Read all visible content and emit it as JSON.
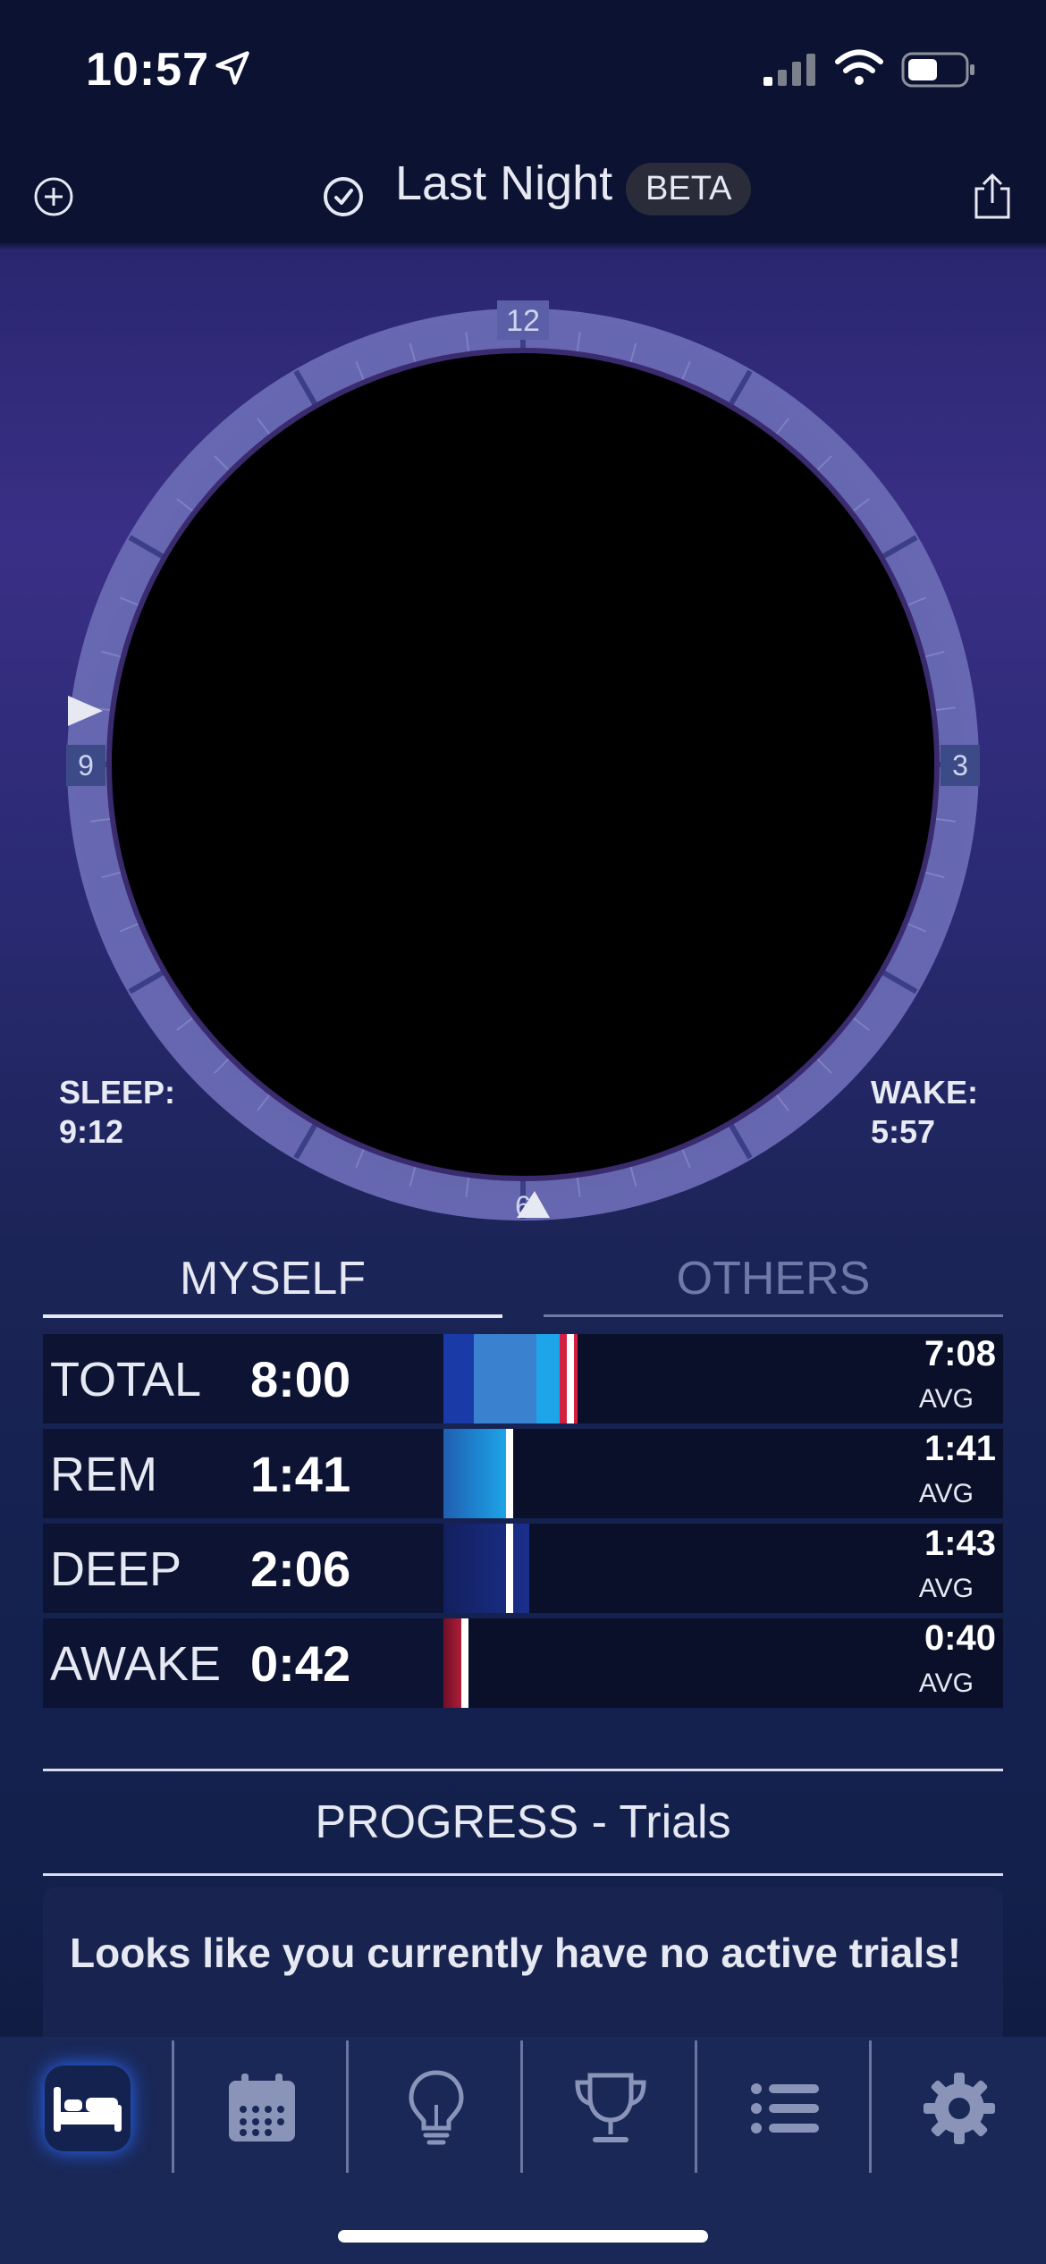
{
  "status_bar": {
    "time": "10:57",
    "icons": [
      "location-arrow-icon",
      "cellular-signal-icon",
      "wifi-icon",
      "battery-icon"
    ]
  },
  "header": {
    "title": "Last Night",
    "badge": "BETA",
    "left_icon": "add-circle-icon",
    "title_icon": "replay-icon",
    "right_icon": "share-icon"
  },
  "dial": {
    "hour_labels": {
      "top": "12",
      "right": "3",
      "bottom": "6",
      "left": "9"
    },
    "sleep_label": "SLEEP:",
    "sleep_time": "9:12",
    "wake_label": "WAKE:",
    "wake_time": "5:57"
  },
  "segments": {
    "myself": "MYSELF",
    "others": "OTHERS",
    "selected": "MYSELF"
  },
  "stats": [
    {
      "label": "TOTAL",
      "value": "8:00",
      "avg": "7:08",
      "avg_label": "AVG"
    },
    {
      "label": "REM",
      "value": "1:41",
      "avg": "1:41",
      "avg_label": "AVG"
    },
    {
      "label": "DEEP",
      "value": "2:06",
      "avg": "1:43",
      "avg_label": "AVG"
    },
    {
      "label": "AWAKE",
      "value": "0:42",
      "avg": "0:40",
      "avg_label": "AVG"
    }
  ],
  "progress": {
    "title": "PROGRESS - Trials",
    "empty_message": "Looks like you currently have no active trials!"
  },
  "tab_bar": {
    "tabs": [
      "bed-icon",
      "calendar-icon",
      "lightbulb-icon",
      "trophy-icon",
      "list-icon",
      "gear-icon"
    ],
    "active": "bed-icon"
  },
  "colors": {
    "background": "#2a2a73",
    "header": "#0b1232",
    "dial_ring": "#6a6db5",
    "rem_bar": "#1ea4e8",
    "deep_bar": "#1a2f8c",
    "awake_bar": "#b01c36",
    "tab_bar": "#1a2858"
  }
}
